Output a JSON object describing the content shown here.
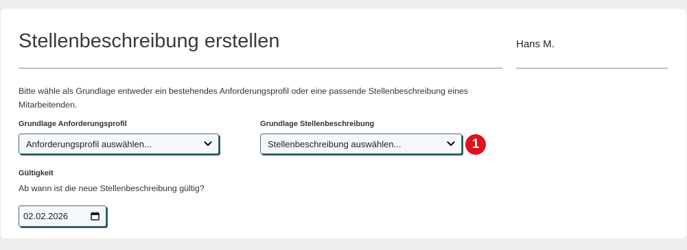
{
  "header": {
    "title": "Stellenbeschreibung erstellen",
    "user_name": "Hans M."
  },
  "form": {
    "intro": "Bitte wähle als Grundlage entweder ein bestehendes Anforderungsprofil oder eine passende Stellenbeschreibung eines Mitarbeitenden.",
    "profile_label": "Grundlage Anforderungsprofil",
    "profile_selected": "Anforderungsprofil auswählen...",
    "description_label": "Grundlage Stellenbeschreibung",
    "description_selected": "Stellenbeschreibung auswählen...",
    "marker_number": "1",
    "validity_label": "Gültigkeit",
    "validity_question": "Ab wann ist die neue Stellenbeschreibung gültig?",
    "validity_date": "02.02.2026"
  },
  "colors": {
    "background": "#efeeee",
    "card": "#ffffff",
    "input_border": "#2c5a5b",
    "marker": "#e0121c"
  },
  "icons": {
    "select_chevron": "chevron-down-icon",
    "date_picker": "calendar-icon"
  }
}
